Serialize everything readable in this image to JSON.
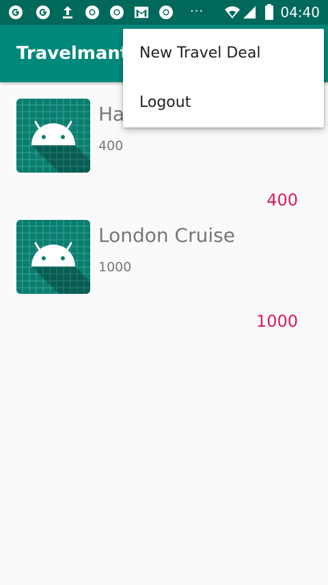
{
  "status_bar": {
    "time": "04:40",
    "dots": "···",
    "icons": [
      "google-icon",
      "google-icon",
      "upload-icon",
      "chrome-icon",
      "chrome-icon",
      "gmail-icon",
      "chrome-icon",
      "wifi-icon",
      "signal-icon",
      "battery-icon"
    ]
  },
  "app_bar": {
    "title": "Travelmantics"
  },
  "deals": [
    {
      "title": "Hawaii",
      "description": "400",
      "price": "400",
      "icon": "android-icon"
    },
    {
      "title": "London Cruise",
      "description": "1000",
      "price": "1000",
      "icon": "android-icon"
    }
  ],
  "menu": {
    "items": [
      "New Travel Deal",
      "Logout"
    ]
  },
  "colors": {
    "status_bar": "#00695c",
    "app_bar": "#00897b",
    "price": "#d81b60",
    "text_secondary": "#757575"
  }
}
